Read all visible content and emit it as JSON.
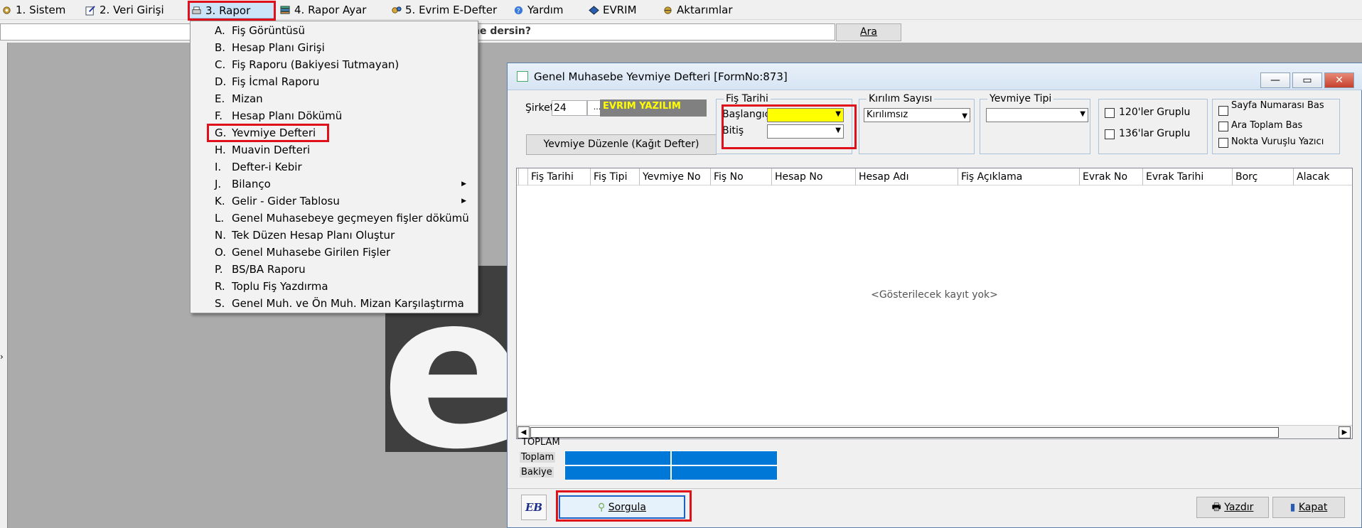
{
  "menubar": {
    "items": [
      {
        "label": "1. Sistem"
      },
      {
        "label": "2.    Veri Girişi"
      },
      {
        "label": "3.   Rapor"
      },
      {
        "label": "4.    Rapor Ayar"
      },
      {
        "label": "5. Evrim E-Defter"
      },
      {
        "label": "Yardım"
      },
      {
        "label": "EVRIM"
      },
      {
        "label": "Aktarımlar"
      }
    ]
  },
  "search": {
    "hint": "ne dersin?",
    "button": "Ara"
  },
  "logo": {
    "letter": "e"
  },
  "rapor_menu": {
    "items": [
      {
        "letter": "A.",
        "label": "Fiş Görüntüsü"
      },
      {
        "letter": "B.",
        "label": "Hesap Planı Girişi"
      },
      {
        "letter": "C.",
        "label": "Fiş Raporu (Bakiyesi Tutmayan)"
      },
      {
        "letter": "D.",
        "label": "Fiş İcmal Raporu"
      },
      {
        "letter": "E.",
        "label": "Mizan"
      },
      {
        "letter": "F.",
        "label": "Hesap Planı Dökümü"
      },
      {
        "letter": "G.",
        "label": "Yevmiye Defteri"
      },
      {
        "letter": "H.",
        "label": "Muavin Defteri"
      },
      {
        "letter": "I.",
        "label": "Defter-i Kebir"
      },
      {
        "letter": "J.",
        "label": "Bilanço"
      },
      {
        "letter": "K.",
        "label": "Gelir - Gider Tablosu"
      },
      {
        "letter": "L.",
        "label": "Genel Muhasebeye geçmeyen fişler dökümü"
      },
      {
        "letter": "N.",
        "label": "Tek Düzen Hesap Planı Oluştur"
      },
      {
        "letter": "O.",
        "label": "Genel Muhasebe Girilen Fişler"
      },
      {
        "letter": "P.",
        "label": "BS/BA Raporu"
      },
      {
        "letter": "R.",
        "label": "Toplu Fiş Yazdırma"
      },
      {
        "letter": "S.",
        "label": "Genel Muh. ve Ön Muh. Mizan Karşılaştırma"
      }
    ]
  },
  "form": {
    "title": "Genel Muhasebe Yevmiye Defteri [FormNo:873]",
    "sirket_label": "Şirket",
    "sirket_code": "24",
    "sirket_lookup": "...",
    "sirket_name": "EVRIM YAZILIM",
    "yevmiye_duzenle": "Yevmiye Düzenle (Kağıt Defter)",
    "fis_tarihi": {
      "title": "Fiş Tarihi",
      "baslangic": "Başlangıç",
      "bitis": "Bitiş"
    },
    "kirilim": {
      "title": "Kırılım Sayısı",
      "value": "Kırılımsız"
    },
    "yevmiye_tipi": {
      "title": "Yevmiye Tipi",
      "value": ""
    },
    "grup": {
      "g120": "120'ler  Gruplu",
      "g136": "136'lar  Gruplu"
    },
    "options": {
      "sayfa": "Sayfa Numarası Bas",
      "ara_toplam": "Ara Toplam Bas",
      "nokta": "Nokta Vuruşlu Yazıcı"
    },
    "columns": [
      "Fiş Tarihi",
      "Fiş Tipi",
      "Yevmiye No",
      "Fiş No",
      "Hesap No",
      "Hesap Adı",
      "Fiş Açıklama",
      "Evrak No",
      "Evrak Tarihi",
      "Borç",
      "Alacak"
    ],
    "empty_text": "<Gösterilecek kayıt yok>",
    "toplam": {
      "title": "TOPLAM",
      "toplam_label": "Toplam",
      "bakiye_label": "Bakiye"
    },
    "buttons": {
      "sorgula": "Sorgula",
      "yazdir": "Yazdır",
      "kapat": "Kapat"
    }
  },
  "colors": {
    "highlight": "#e0101a",
    "active_field": "#ffff00",
    "total_cell": "#0078d7",
    "company_label": "#ffff00"
  }
}
